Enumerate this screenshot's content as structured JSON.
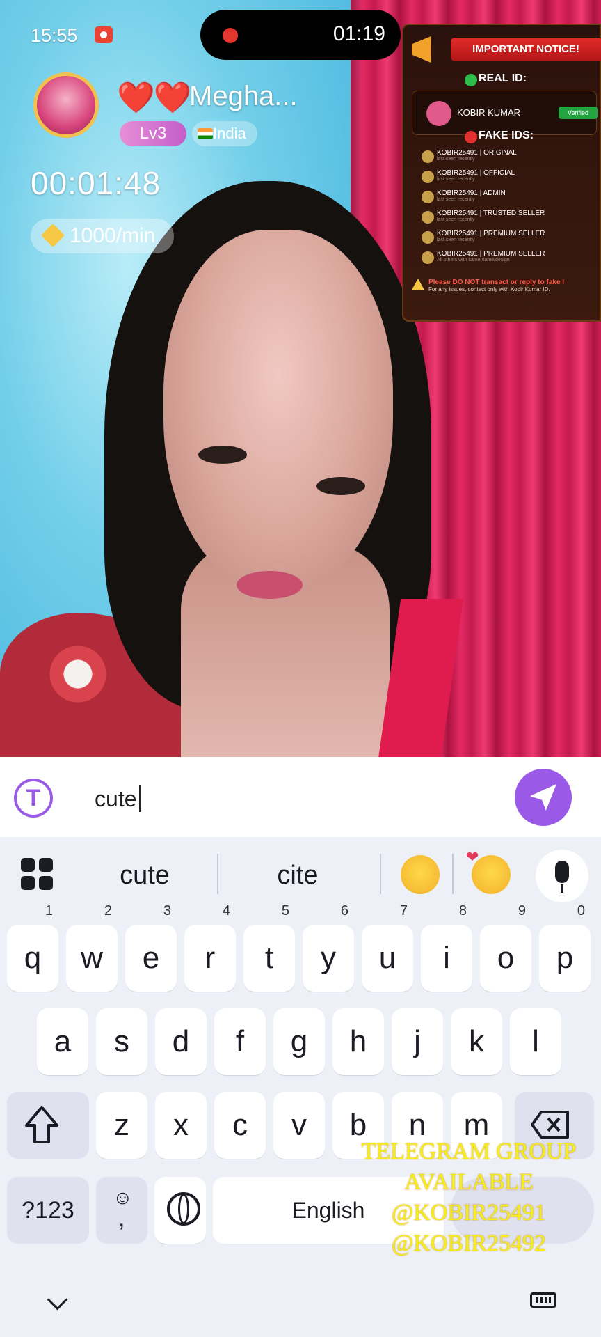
{
  "status_bar": {
    "time": "15:55",
    "recording_time": "01:19"
  },
  "caller": {
    "hearts": "❤️❤️",
    "name": "Megha...",
    "level": "Lv3",
    "country": "India",
    "call_timer": "00:01:48",
    "rate": "1000/min"
  },
  "notice": {
    "title": "IMPORTANT NOTICE!",
    "real_label": "REAL ID:",
    "real_name": "KOBIR KUMAR",
    "verified": "Verified",
    "fake_label": "FAKE IDS:",
    "fake_ids": [
      {
        "name": "KOBIR25491 | ORIGINAL",
        "sub": "last seen recently"
      },
      {
        "name": "KOBIR25491 | OFFICIAL",
        "sub": "last seen recently"
      },
      {
        "name": "KOBIR25491 | ADMIN",
        "sub": "last seen recently"
      },
      {
        "name": "KOBIR25491 | TRUSTED SELLER",
        "sub": "last seen recently"
      },
      {
        "name": "KOBIR25491 | PREMIUM SELLER",
        "sub": "last seen recently"
      },
      {
        "name": "KOBIR25491 | PREMIUM SELLER",
        "sub": "All others with same name/design"
      }
    ],
    "footer": "Please DO NOT transact or reply to fake I",
    "footer_sub": "For any issues, contact only with Kobir Kumar ID."
  },
  "composer": {
    "value": "cute"
  },
  "keyboard": {
    "suggestions": [
      "cute",
      "cite"
    ],
    "row1": [
      {
        "key": "q",
        "hint": "1"
      },
      {
        "key": "w",
        "hint": "2"
      },
      {
        "key": "e",
        "hint": "3"
      },
      {
        "key": "r",
        "hint": "4"
      },
      {
        "key": "t",
        "hint": "5"
      },
      {
        "key": "y",
        "hint": "6"
      },
      {
        "key": "u",
        "hint": "7"
      },
      {
        "key": "i",
        "hint": "8"
      },
      {
        "key": "o",
        "hint": "9"
      },
      {
        "key": "p",
        "hint": "0"
      }
    ],
    "row2": [
      "a",
      "s",
      "d",
      "f",
      "g",
      "h",
      "j",
      "k",
      "l"
    ],
    "row3": [
      "z",
      "x",
      "c",
      "v",
      "b",
      "n",
      "m"
    ],
    "symbols_label": "?123",
    "emoji_comma_label": ",",
    "space_label": "English"
  },
  "overlay": {
    "lines": [
      "TELEGRAM GROUP",
      "AVAILABLE",
      "@KOBIR25491",
      "@KOBIR25492"
    ]
  }
}
